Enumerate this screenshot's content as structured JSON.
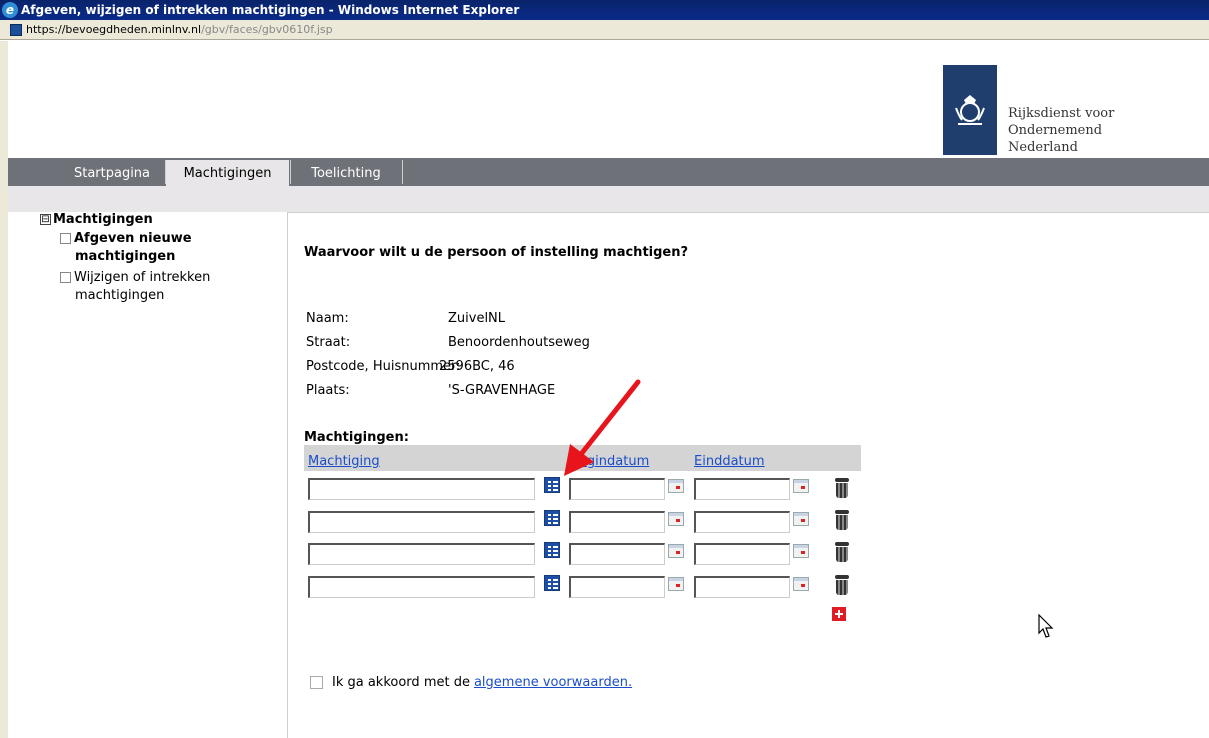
{
  "window": {
    "title": "Afgeven, wijzigen of intrekken machtigingen - Windows Internet Explorer",
    "url_host": "https://bevoegdheden.minlnv.nl",
    "url_path": "/gbv/faces/gbv0610f.jsp"
  },
  "header": {
    "org_line1": "Rijksdienst voor Ondernemend",
    "org_line2": "Nederland",
    "logo_color": "#1f3d6d"
  },
  "nav": {
    "tabs": [
      {
        "label": "Startpagina",
        "active": false
      },
      {
        "label": "Machtigingen",
        "active": true
      },
      {
        "label": "Toelichting",
        "active": false
      }
    ]
  },
  "menu": {
    "root_label": "Machtigingen",
    "root_glyph": "⊟",
    "item1_line1": "Afgeven nieuwe",
    "item1_line2": "machtigingen",
    "item2_line1": "Wijzigen of intrekken",
    "item2_line2": "machtigingen"
  },
  "main": {
    "question": "Waarvoor wilt u de persoon of instelling machtigen?",
    "info": [
      {
        "label": "Naam:",
        "value": "ZuivelNL"
      },
      {
        "label": "Straat:",
        "value": "Benoordenhoutseweg"
      },
      {
        "label": "Postcode, Huisnummer:",
        "value": "2596BC, 46"
      },
      {
        "label": "Plaats:",
        "value": "'S-GRAVENHAGE"
      }
    ],
    "machtigingen_title": "Machtigingen:",
    "columns": {
      "machtiging": "Machtiging",
      "begindatum": "Begindatum",
      "einddatum": "Einddatum"
    },
    "rows": [
      {
        "machtiging": "",
        "begindatum": "",
        "einddatum": ""
      },
      {
        "machtiging": "",
        "begindatum": "",
        "einddatum": ""
      },
      {
        "machtiging": "",
        "begindatum": "",
        "einddatum": ""
      },
      {
        "machtiging": "",
        "begindatum": "",
        "einddatum": ""
      }
    ],
    "agree_text": "Ik ga akkoord met de",
    "agree_link": "algemene voorwaarden.",
    "link_color": "#1a4ec8",
    "annotation_arrow_color": "#e8141b"
  }
}
